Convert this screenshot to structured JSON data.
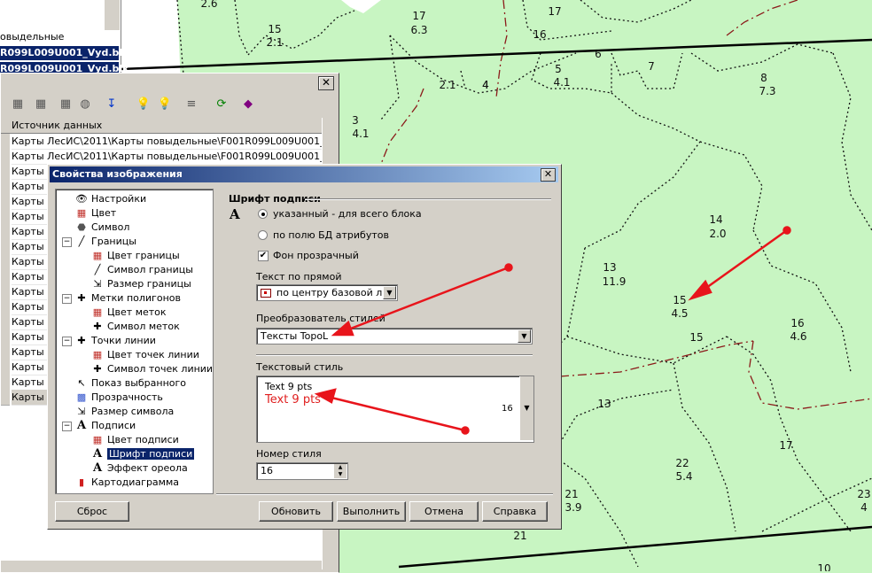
{
  "map": {
    "labels": [
      {
        "text": "2.6"
      },
      {
        "text": "15"
      },
      {
        "text": "2.1"
      },
      {
        "text": "17"
      },
      {
        "text": "6.3"
      },
      {
        "text": "17"
      },
      {
        "text": "16"
      },
      {
        "text": "5"
      },
      {
        "text": "4.1"
      },
      {
        "text": "6"
      },
      {
        "text": "7"
      },
      {
        "text": "4"
      },
      {
        "text": "2.1"
      },
      {
        "text": "4"
      },
      {
        "text": "8"
      },
      {
        "text": "7.3"
      },
      {
        "text": "3"
      },
      {
        "text": "4.1"
      },
      {
        "text": "14"
      },
      {
        "text": "2.0"
      },
      {
        "text": "13"
      },
      {
        "text": "11.9"
      },
      {
        "text": "15"
      },
      {
        "text": "4.5"
      },
      {
        "text": "16"
      },
      {
        "text": "4.6"
      },
      {
        "text": "15"
      },
      {
        "text": "13"
      },
      {
        "text": "17"
      },
      {
        "text": "22"
      },
      {
        "text": "5.4"
      },
      {
        "text": "21"
      },
      {
        "text": "3.9"
      },
      {
        "text": "21"
      },
      {
        "text": "23"
      },
      {
        "text": "4"
      },
      {
        "text": "10"
      }
    ]
  },
  "bg_panel": {
    "row1": "овыдельные",
    "row2": "R099L009U001_Vyd.blk",
    "row3": "R099L009U001_Vyd.blk"
  },
  "layers": {
    "column_header": "Источник данных",
    "rows": [
      "Карты ЛесИС\\2011\\Карты повыдельные\\F001R099L009U001_VydL.blk\\M",
      "Карты ЛесИС\\2011\\Карты повыдельные\\F001R099L009U001_VydL.blk\\P",
      "Карты",
      "Карты",
      "Карты",
      "Карты",
      "Карты",
      "Карты",
      "Карты",
      "Карты",
      "Карты",
      "Карты",
      "Карты",
      "Карты",
      "Карты",
      "Карты",
      "Карты",
      "Карты"
    ]
  },
  "dialog": {
    "title": "Свойства изображения",
    "close": "✕",
    "tree": [
      {
        "label": "Настройки",
        "icon": "eye-icon"
      },
      {
        "label": "Цвет",
        "icon": "palette-icon"
      },
      {
        "label": "Символ",
        "icon": "shape-icon"
      },
      {
        "label": "Границы",
        "icon": "line-icon"
      },
      {
        "label": "Цвет границы",
        "icon": "palette-icon"
      },
      {
        "label": "Символ границы",
        "icon": "line-icon"
      },
      {
        "label": "Размер границы",
        "icon": "size-icon"
      },
      {
        "label": "Метки полигонов",
        "icon": "cross-icon"
      },
      {
        "label": "Цвет меток",
        "icon": "palette-icon"
      },
      {
        "label": "Символ меток",
        "icon": "cross-icon"
      },
      {
        "label": "Точки линии",
        "icon": "cross-icon"
      },
      {
        "label": "Цвет точек линии",
        "icon": "palette-icon"
      },
      {
        "label": "Символ точек линии",
        "icon": "cross-icon"
      },
      {
        "label": "Показ выбранного",
        "icon": "pointer-icon"
      },
      {
        "label": "Прозрачность",
        "icon": "transparency-icon"
      },
      {
        "label": "Размер символа",
        "icon": "size-icon"
      },
      {
        "label": "Подписи",
        "icon": "font-icon"
      },
      {
        "label": "Цвет подписи",
        "icon": "palette-icon"
      },
      {
        "label": "Шрифт подписи",
        "icon": "font-icon"
      },
      {
        "label": "Эффект ореола",
        "icon": "font-icon"
      },
      {
        "label": "Картодиаграмма",
        "icon": "chart-icon"
      }
    ],
    "group_title": "Шрифт подписи",
    "radio_specified": "указанный - для всего блока",
    "radio_by_field": "по полю БД атрибутов",
    "checkbox_transparent": "Фон прозрачный",
    "text_on_line_label": "Текст по прямой",
    "text_on_line_value": "по центру базовой л...",
    "style_converter_label": "Преобразователь стилей",
    "style_converter_value": "Тексты TopoL",
    "text_style_label": "Текстовый стиль",
    "text_style_line1": "Text 9 pts",
    "text_style_line2": "Text 9 pts",
    "text_style_number": "16",
    "style_number_label": "Номер стиля",
    "style_number_value": "16",
    "btn_reset": "Сброс",
    "btn_refresh": "Обновить",
    "btn_apply": "Выполнить",
    "btn_cancel": "Отмена",
    "btn_help": "Справка"
  },
  "colors": {
    "map_bg": "#c8f5c2",
    "selection": "#0a246a",
    "annotation_red": "#e8141b",
    "preview_red": "#e02020"
  }
}
